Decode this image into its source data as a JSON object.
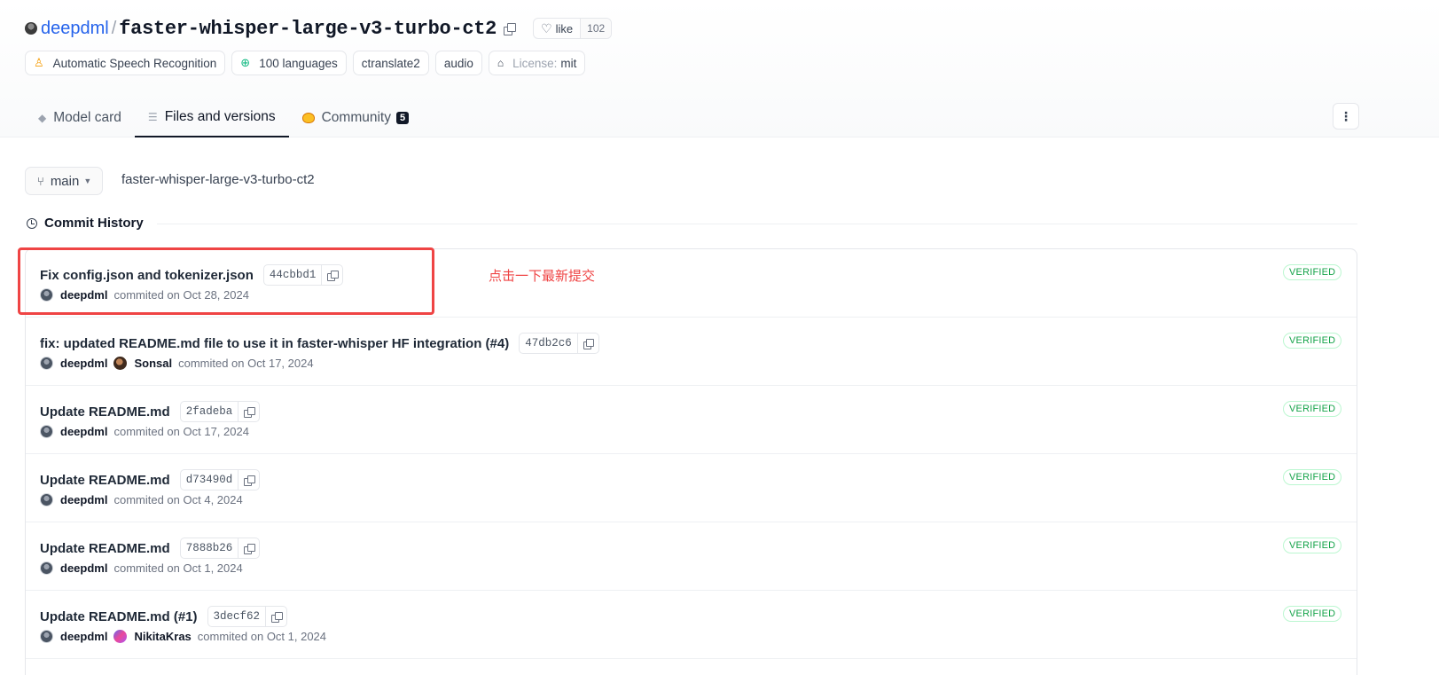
{
  "repo": {
    "owner": "deepdml",
    "name": "faster-whisper-large-v3-turbo-ct2",
    "like_label": "like",
    "like_count": "102"
  },
  "tags": [
    {
      "label": "Automatic Speech Recognition",
      "icon": "speech-icon"
    },
    {
      "label": "100 languages",
      "icon": "globe-icon"
    },
    {
      "label": "ctranslate2"
    },
    {
      "label": "audio"
    },
    {
      "key": "License:",
      "value": "mit",
      "icon": "license-icon"
    }
  ],
  "tabs": [
    {
      "label": "Model card",
      "icon": "cube-icon"
    },
    {
      "label": "Files and versions",
      "icon": "files-icon",
      "active": true
    },
    {
      "label": "Community",
      "icon": "community-icon",
      "badge": "5"
    }
  ],
  "branch": {
    "label": "main"
  },
  "path": "faster-whisper-large-v3-turbo-ct2",
  "history_title": "Commit History",
  "annotation": "点击一下最新提交",
  "verified_label": "VERIFIED",
  "commits": [
    {
      "message": "Fix config.json and tokenizer.json",
      "hash": "44cbbd1",
      "authors": [
        "deepdml"
      ],
      "date": "commited on Oct 28, 2024"
    },
    {
      "message": "fix: updated README.md file to use it in faster-whisper HF integration (#4)",
      "hash": "47db2c6",
      "authors": [
        "deepdml",
        "Sonsal"
      ],
      "date": "commited on Oct 17, 2024"
    },
    {
      "message": "Update README.md",
      "hash": "2fadeba",
      "authors": [
        "deepdml"
      ],
      "date": "commited on Oct 17, 2024"
    },
    {
      "message": "Update README.md",
      "hash": "d73490d",
      "authors": [
        "deepdml"
      ],
      "date": "commited on Oct 4, 2024"
    },
    {
      "message": "Update README.md",
      "hash": "7888b26",
      "authors": [
        "deepdml"
      ],
      "date": "commited on Oct 1, 2024"
    },
    {
      "message": "Update README.md (#1)",
      "hash": "3decf62",
      "authors": [
        "deepdml",
        "NikitaKras"
      ],
      "date": "commited on Oct 1, 2024"
    }
  ]
}
